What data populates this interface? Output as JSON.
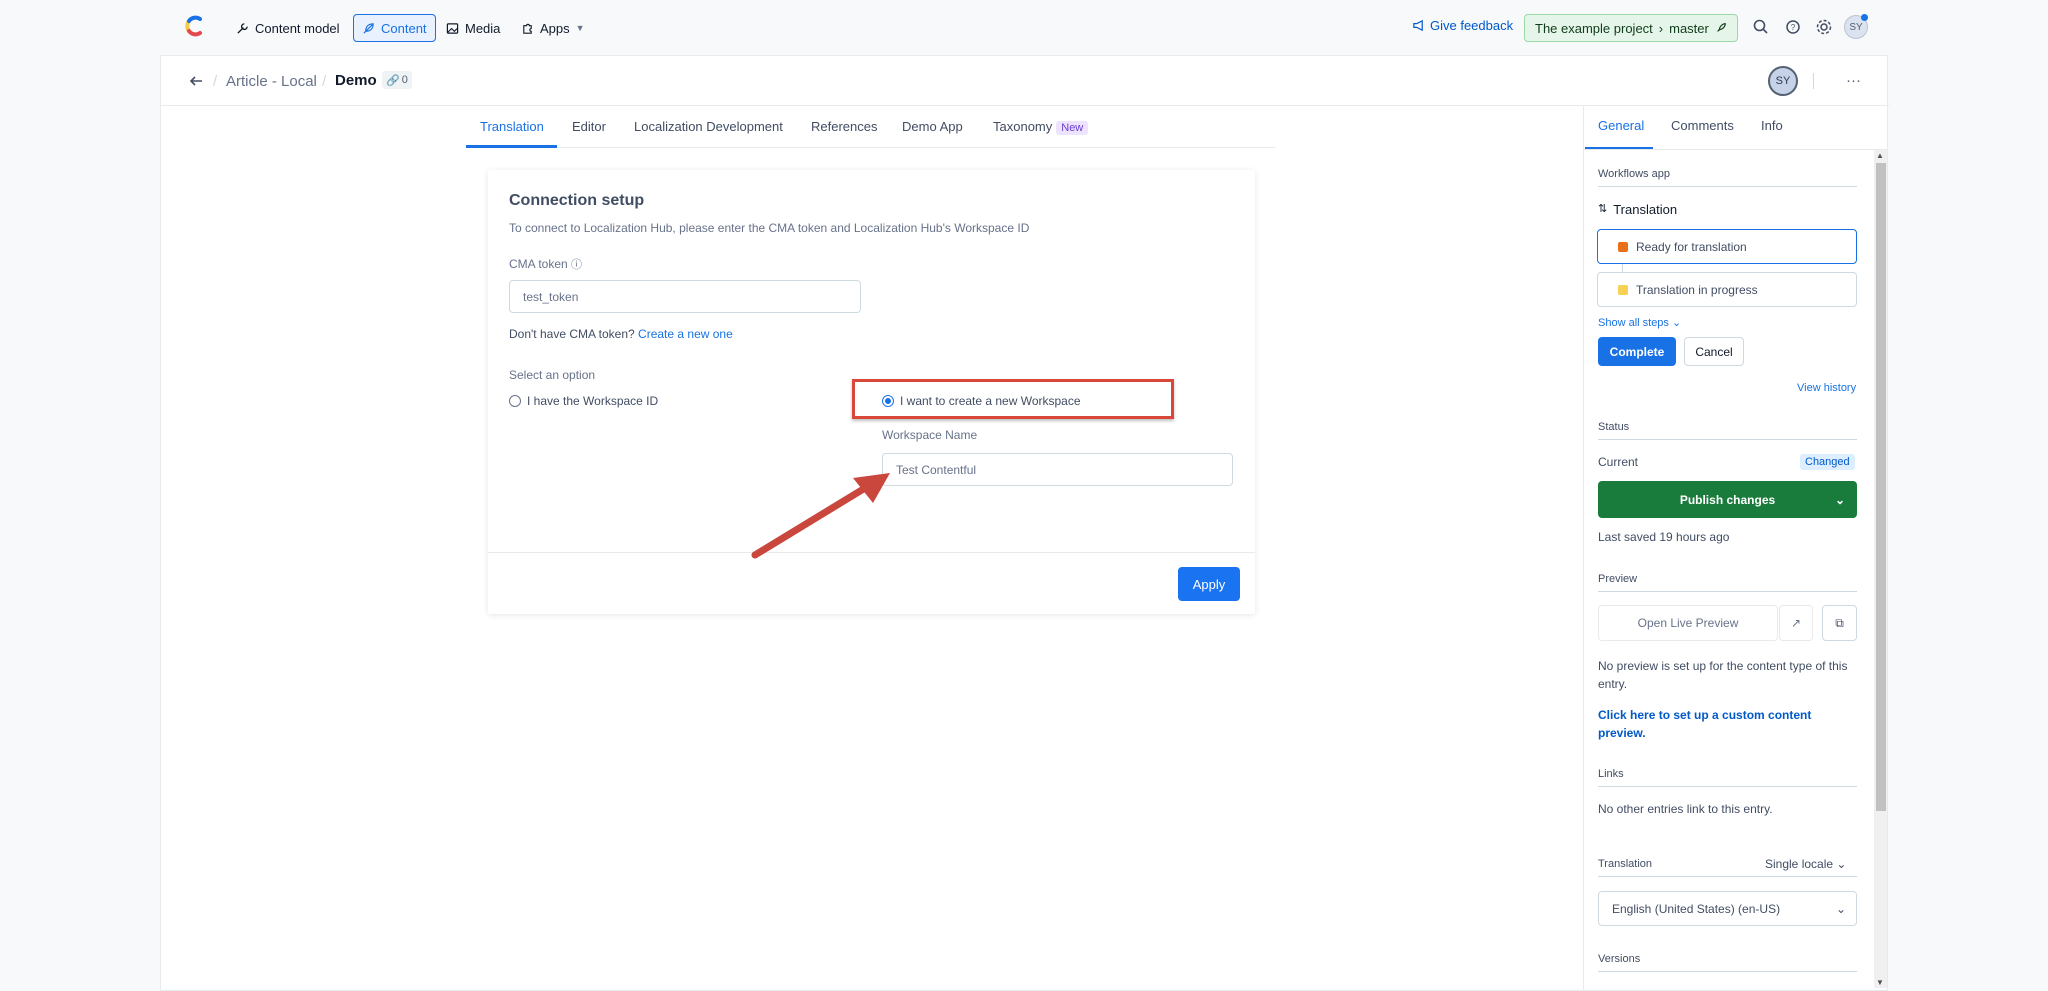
{
  "topbar": {
    "nav": [
      {
        "label": "Content model",
        "icon": "wrench-icon"
      },
      {
        "label": "Content",
        "icon": "feather-icon"
      },
      {
        "label": "Media",
        "icon": "image-icon"
      },
      {
        "label": "Apps",
        "icon": "puzzle-icon"
      }
    ],
    "feedback": "Give feedback",
    "project": "The example project",
    "environment": "master",
    "user_initials": "SY"
  },
  "entry": {
    "breadcrumb": "Article - Local",
    "title": "Demo",
    "ref_count": "0",
    "avatar": "SY",
    "more": "···"
  },
  "tabs": [
    "Translation",
    "Editor",
    "Localization Development",
    "References",
    "Demo App",
    "Taxonomy"
  ],
  "tab_badge": "New",
  "connection": {
    "heading": "Connection setup",
    "description": "To connect to Localization Hub, please enter the CMA token and Localization Hub's Workspace ID",
    "token_label": "CMA token",
    "token_value": "test_token",
    "no_token_text": "Don't have CMA token?",
    "create_link": "Create a new one",
    "option_label": "Select an option",
    "option_1": "I have the Workspace ID",
    "option_2": "I want to create a new Workspace",
    "workspace_label": "Workspace Name",
    "workspace_value": "Test Contentful",
    "apply": "Apply"
  },
  "sidebar": {
    "tabs": [
      "General",
      "Comments",
      "Info"
    ],
    "workflows_heading": "Workflows app",
    "workflow_name": "Translation",
    "steps": [
      "Ready for translation",
      "Translation in progress"
    ],
    "show_all": "Show all steps",
    "complete": "Complete",
    "cancel": "Cancel",
    "view_history": "View history",
    "status_heading": "Status",
    "current": "Current",
    "changed": "Changed",
    "publish": "Publish changes",
    "last_saved": "Last saved 19 hours ago",
    "preview_heading": "Preview",
    "open_preview": "Open Live Preview",
    "no_preview": "No preview is set up for the content type of this entry.",
    "setup_preview": "Click here to set up a custom content preview.",
    "links_heading": "Links",
    "no_links": "No other entries link to this entry.",
    "translation_heading": "Translation",
    "locale_mode": "Single locale",
    "locale": "English (United States) (en-US)",
    "versions_heading": "Versions"
  },
  "colors": {
    "accent": "#1872e5",
    "publish": "#1a7c3c",
    "highlight": "#d9473b",
    "step_ready": "#e8701a",
    "step_progress": "#f7d154"
  }
}
